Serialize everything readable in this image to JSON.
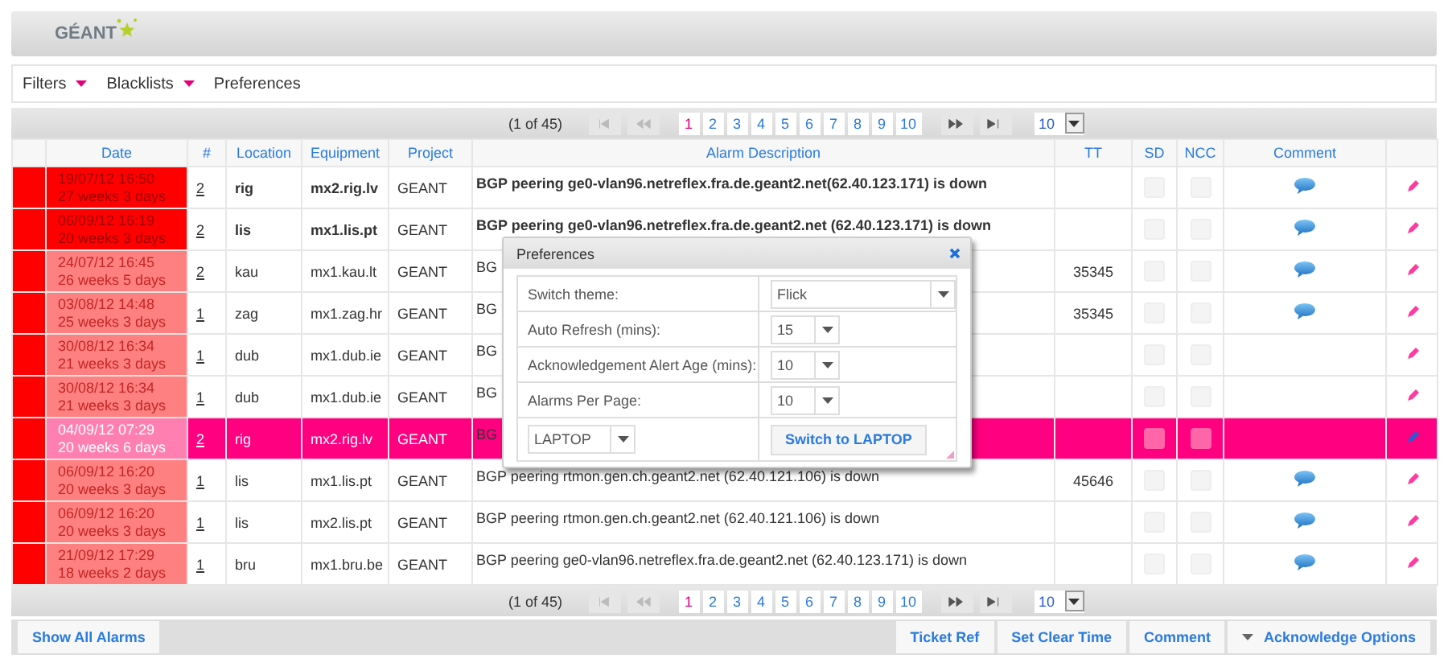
{
  "logo": {
    "text": "GÉANT"
  },
  "menu": [
    {
      "label": "Filters",
      "dropdown": true
    },
    {
      "label": "Blacklists",
      "dropdown": true
    },
    {
      "label": "Preferences",
      "dropdown": false
    }
  ],
  "paginators": [
    {
      "summary": "(1 of 45)",
      "nav": [
        {
          "kind": "first",
          "disabled": true
        },
        {
          "kind": "prev",
          "disabled": true
        },
        {
          "kind": "next",
          "disabled": false
        },
        {
          "kind": "last",
          "disabled": false
        }
      ],
      "pages": [
        {
          "label": "1",
          "selected": true
        },
        {
          "label": "2",
          "selected": false
        },
        {
          "label": "3",
          "selected": false
        },
        {
          "label": "4",
          "selected": false
        },
        {
          "label": "5",
          "selected": false
        },
        {
          "label": "6",
          "selected": false
        },
        {
          "label": "7",
          "selected": false
        },
        {
          "label": "8",
          "selected": false
        },
        {
          "label": "9",
          "selected": false
        },
        {
          "label": "10",
          "selected": false
        }
      ],
      "per_page": "10"
    },
    {
      "summary": "(1 of 45)",
      "nav": [
        {
          "kind": "first",
          "disabled": true
        },
        {
          "kind": "prev",
          "disabled": true
        },
        {
          "kind": "next",
          "disabled": false
        },
        {
          "kind": "last",
          "disabled": false
        }
      ],
      "pages": [
        {
          "label": "1",
          "selected": true
        },
        {
          "label": "2",
          "selected": false
        },
        {
          "label": "3",
          "selected": false
        },
        {
          "label": "4",
          "selected": false
        },
        {
          "label": "5",
          "selected": false
        },
        {
          "label": "6",
          "selected": false
        },
        {
          "label": "7",
          "selected": false
        },
        {
          "label": "8",
          "selected": false
        },
        {
          "label": "9",
          "selected": false
        },
        {
          "label": "10",
          "selected": false
        }
      ],
      "per_page": "10"
    }
  ],
  "table": {
    "columns": [
      "Date",
      "#",
      "Location",
      "Equipment",
      "Project",
      "Alarm Description",
      "TT",
      "SD",
      "NCC",
      "Comment"
    ],
    "rows": [
      {
        "color": "#ff0000",
        "date": "19/07/12 16:50",
        "age": "27 weeks 3 days",
        "count": "2",
        "location": "rig",
        "equipment": "mx2.rig.lv",
        "project": "GEANT",
        "description": "BGP peering ge0-vlan96.netreflex.fra.de.geant2.net(62.40.123.171) is down",
        "sd": false,
        "ncc": false,
        "comment": true,
        "new": true,
        "selected": false
      },
      {
        "color": "#ff0000",
        "date": "06/09/12 16:19",
        "age": "20 weeks 3 days",
        "count": "2",
        "location": "lis",
        "equipment": "mx1.lis.pt",
        "project": "GEANT",
        "description": "BGP peering ge0-vlan96.netreflex.fra.de.geant2.net (62.40.123.171) is down",
        "sd": false,
        "ncc": false,
        "comment": true,
        "new": true,
        "selected": false
      },
      {
        "color": "#ff0000",
        "date": "24/07/12 16:45",
        "age": "26 weeks 5 days",
        "count": "2",
        "location": "kau",
        "equipment": "mx1.kau.lt",
        "project": "GEANT",
        "description": "BG",
        "tt": "35345",
        "sd": false,
        "ncc": false,
        "comment": true,
        "new": false,
        "selected": false
      },
      {
        "color": "#ff0000",
        "date": "03/08/12 14:48",
        "age": "25 weeks 3 days",
        "count": "1",
        "location": "zag",
        "equipment": "mx1.zag.hr",
        "project": "GEANT",
        "description": "BG",
        "tt": "35345",
        "sd": false,
        "ncc": false,
        "comment": true,
        "new": false,
        "selected": false
      },
      {
        "color": "#ff0000",
        "date": "30/08/12 16:34",
        "age": "21 weeks 3 days",
        "count": "1",
        "location": "dub",
        "equipment": "mx1.dub.ie",
        "project": "GEANT",
        "description": "BG",
        "sd": false,
        "ncc": false,
        "comment": false,
        "new": false,
        "selected": false
      },
      {
        "color": "#ff0000",
        "date": "30/08/12 16:34",
        "age": "21 weeks 3 days",
        "count": "1",
        "location": "dub",
        "equipment": "mx1.dub.ie",
        "project": "GEANT",
        "description": "BG",
        "sd": false,
        "ncc": false,
        "comment": false,
        "new": false,
        "selected": false
      },
      {
        "color": "#ff0000",
        "date": "04/09/12 07:29",
        "age": "20 weeks 6 days",
        "count": "2",
        "location": "rig",
        "equipment": "mx2.rig.lv",
        "project": "GEANT",
        "description": "BG",
        "sd": false,
        "ncc": false,
        "comment": false,
        "new": false,
        "selected": true
      },
      {
        "color": "#ff0000",
        "date": "06/09/12 16:20",
        "age": "20 weeks 3 days",
        "count": "1",
        "location": "lis",
        "equipment": "mx1.lis.pt",
        "project": "GEANT",
        "description": "BGP peering rtmon.gen.ch.geant2.net (62.40.121.106) is down",
        "tt": "45646",
        "sd": false,
        "ncc": false,
        "comment": true,
        "new": false,
        "selected": false
      },
      {
        "color": "#ff0000",
        "date": "06/09/12 16:20",
        "age": "20 weeks 3 days",
        "count": "1",
        "location": "lis",
        "equipment": "mx2.lis.pt",
        "project": "GEANT",
        "description": "BGP peering rtmon.gen.ch.geant2.net (62.40.121.106) is down",
        "sd": false,
        "ncc": false,
        "comment": true,
        "new": false,
        "selected": false
      },
      {
        "color": "#ff0000",
        "date": "21/09/12 17:29",
        "age": "18 weeks 2 days",
        "count": "1",
        "location": "bru",
        "equipment": "mx1.bru.be",
        "project": "GEANT",
        "description": "BGP peering ge0-vlan96.netreflex.fra.de.geant2.net (62.40.123.171) is down",
        "sd": false,
        "ncc": false,
        "comment": true,
        "new": false,
        "selected": false
      }
    ]
  },
  "dialog": {
    "title": "Preferences",
    "fields": [
      {
        "label": "Switch theme:",
        "value": "Flick",
        "kind": "wide"
      },
      {
        "label": "Auto Refresh (mins):",
        "value": "15",
        "kind": "narrow"
      },
      {
        "label": "Acknowledgement Alert Age (mins):",
        "value": "10",
        "kind": "narrow"
      },
      {
        "label": "Alarms Per Page:",
        "value": "10",
        "kind": "narrow"
      }
    ],
    "device": "LAPTOP",
    "device_button": "Switch to LAPTOP"
  },
  "left_buttons": [
    {
      "label": "Show All Alarms",
      "dropdown": false
    }
  ],
  "right_buttons": [
    {
      "label": "Ticket Ref",
      "dropdown": false
    },
    {
      "label": "Set Clear Time",
      "dropdown": false
    },
    {
      "label": "Comment",
      "dropdown": false
    },
    {
      "label": "Acknowledge Options",
      "dropdown": true
    }
  ]
}
